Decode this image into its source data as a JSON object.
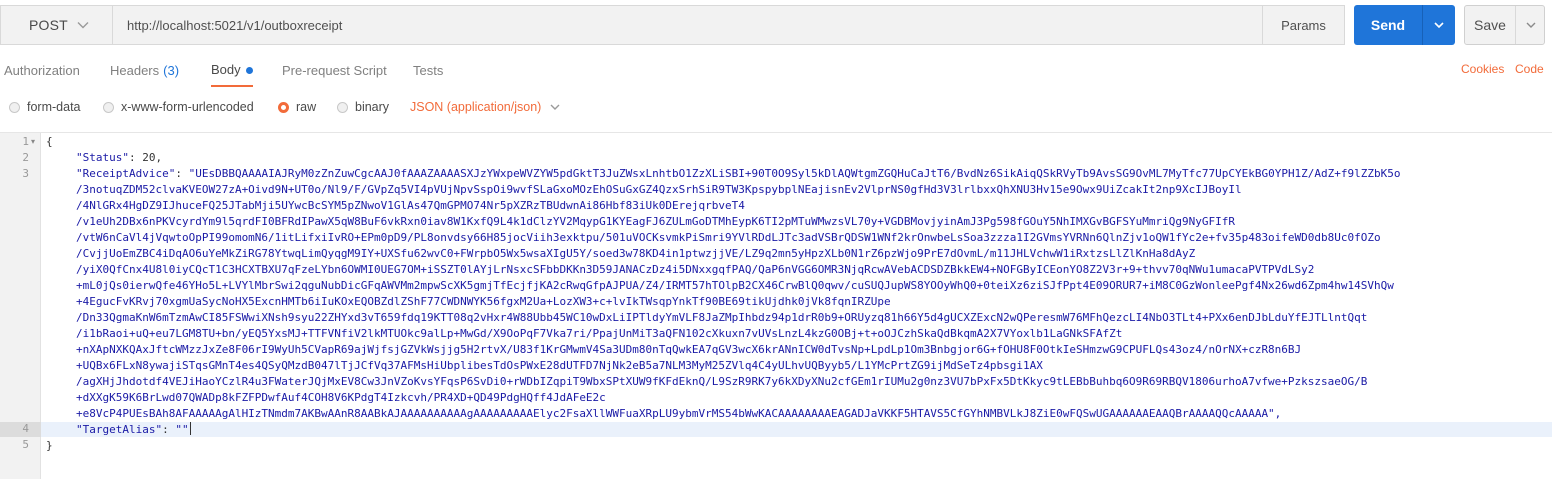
{
  "request": {
    "method": "POST",
    "url": "http://localhost:5021/v1/outboxreceipt",
    "params_label": "Params",
    "send_label": "Send",
    "save_label": "Save"
  },
  "tabs": [
    {
      "label": "Authorization"
    },
    {
      "label": "Headers",
      "count": "(3)"
    },
    {
      "label": "Body",
      "active": true
    },
    {
      "label": "Pre-request Script"
    },
    {
      "label": "Tests"
    }
  ],
  "right_links": {
    "cookies": "Cookies",
    "code": "Code"
  },
  "body_types": [
    {
      "label": "form-data",
      "selected": false
    },
    {
      "label": "x-www-form-urlencoded",
      "selected": false
    },
    {
      "label": "raw",
      "selected": true
    },
    {
      "label": "binary",
      "selected": false
    }
  ],
  "content_type": "JSON (application/json)",
  "editor": {
    "line_numbers": [
      "1",
      "2",
      "3",
      "4",
      "5"
    ],
    "open_brace": "{",
    "close_brace": "}",
    "status_key": "\"Status\"",
    "status_value": "20",
    "receipt_key": "\"ReceiptAdvice\"",
    "target_key": "\"TargetAlias\"",
    "target_value": "\"\"",
    "receipt_lines": [
      "\"UEsDBBQAAAAIAJRyM0zZnZuwCgcAAJ0fAAAZAAAASXJzYWxpeWVZYW5pdGktT3JuZWsxLnhtbO1ZzXLiSBI+90T0O9Syl5kDlAQWtgmZGQHuCaJtT6/BvdNz6SikAiqQSkRVyTb9AvsSG9OvML7MyTfc77UpCYEkBG0YPH1Z/AdZ+f9lZZbK5o",
      "/3notuqZDM52clvaKVEOW27zA+Oivd9N+UT0o/Nl9/F/GVpZq5VI4pVUjNpvSspOi9wvfSLaGxoMOzEhOSuGxGZ4QzxSrhSiR9TW3KpspybplNEajisnEv2VlprNS0gfHd3V3lrlbxxQhXNU3Hv15e9Owx9UiZcakIt2np9XcIJBoyIl",
      "/4NlGRx4HgDZ9IJhuceFQ25JTabMji5UYwcBcSYM5pZNwoV1GlAs47QmGPMO74Nr5pXZRzTBUdwnAi86Hbf83iUk0DErejqrbveT4",
      "/v1eUh2DBx6nPKVcyrdYm9l5qrdFI0BFRdIPawX5qW8BuF6vkRxn0iav8W1KxfQ9L4k1dClzYV2MqypG1KYEagFJ6ZULmGoDTMhEypK6TI2pMTuWMwzsVL70y+VGDBMovjyinAmJ3Pg598fGOuY5NhIMXGvBGFSYuMmriQg9NyGFIfR",
      "/vtW6nCaVl4jVqwtoOpPI99omomN6/1itLifxiIvRO+EPm0pD9/PL8onvdsy66H85jocViih3exktpu/501uVOCKsvmkPiSmri9YVlRDdLJTc3adVSBrQDSW1WNf2krOnwbeLsSoa3zzza1I2GVmsYVRNn6QlnZjv1oQW1fYc2e+fv35p483oifeWD0db8Uc0fOZo",
      "/CvjjUoEmZBC4iDqAO6uYeMkZiRG78YtwqLimQyqgM9IY+UXSfu62wvC0+FWrpbO5Wx5wsaXIgU5Y/soed3w78KD4in1ptwzjjVE/LZ9q2mn5yHpzXLb0N1rZ6pzWjo9PrE7dOvmL/m11JHLVchwW1iRxtzsLlZlKnHa8dAyZ",
      "/yiX0QfCnx4U8l0iyCQcT1C3HCXTBXU7qFzeLYbn6OWMI0UEG7OM+iSSZT0lAYjLrNsxcSFbbDKKn3D59JANACzDz4i5DNxxgqfPAQ/QaP6nVGG6OMR3NjqRcwAVebACDSDZBkkEW4+NOFGByICEonYO8Z2V3r+9+thvv70qNWu1umacaPVTPVdLSy2",
      "+mL0jQs0ierwQfe46YHo5L+LVYlMbrSwi2qguNubDicGFqAWVMm2mpwScXK5gmjTfEcjfjKA2cRwqGfpAJPUA/Z4/IRMT57hTOlpB2CX46CrwBlQ0qwv/cuSUQJupWS8YOOyWhQ0+0teiXz6ziSJfPpt4E09ORUR7+iM8C0GzWonleePgf4Nx26wd6Zpm4hw14SVhQw",
      "+4EgucFvKRvj70xgmUaSycNoHX5ExcnHMTb6iIuKOxEQOBZdlZShF77CWDNWYK56fgxM2Ua+LozXW3+c+lvIkTWsqpYnkTf90BE69tikUjdhk0jVk8fqnIRZUpe",
      "/Dn33QgmaKnW6mTzmAwCI85FSWwiXNsh9syu22ZHYxd3vT659fdq19KTT08q2vHxr4W88Ubb45WC10wDxLiIPTldyYmVLF8JaZMpIhbdz94p1drR0b9+ORUyzq81h66Y5d4gUCXZExcN2wQPeresmW76MFhQezcLI4NbO3TLt4+PXx6enDJbLduYfEJTLlntQqt",
      "/i1bRaoi+uQ+eu7LGM8TU+bn/yEQ5YxsMJ+TTFVNfiV2lkMTUOkc9alLp+MwGd/X9OoPqF7Vka7ri/PpajUnMiT3aQFN102cXkuxn7vUVsLnzL4kzG0OBj+t+oOJCzhSkaQdBkqmA2X7VYoxlb1LaGNkSFAfZt",
      "+nXApNXKQAxJftcWMzzJxZe8F06rI9WyUh5CVapR69ajWjfsjGZVkWsjjg5H2rtvX/U83f1KrGMwmV4Sa3UDm80nTqQwkEA7qGV3wcX6krANnICW0dTvsNp+LpdLp1Om3Bnbgjor6G+fOHU8F0OtkIeSHmzwG9CPUFLQs43oz4/nOrNX+czR8n6BJ",
      "+UQBx6FLxN8ywajiSTqsGMnT4es4QSyQMzdB047lTjJCfVq37AFMsHiUbplibesTdOsPWxE28dUTFD7NjNk2eB5a7NLM3MyM25ZVlq4C4yULhvUQByyb5/L1YMcPrtZG9ijMdSeTz4pbsgi1AX",
      "/agXHjJhdotdf4VEJiHaoYCzlR4u3FWaterJQjMxEV8Cw3JnVZoKvsYFqsP6SvDi0+rWDbIZqpiT9WbxSPtXUW9fKFdEknQ/L9SzR9RK7y6kXDyXNu2cfGEm1rIUMu2g0nz3VU7bPxFx5DtKkyc9tLEBbBuhbq6O9R69RBQV1806urhoA7vfwe+PzkszsaeOG/B",
      "+dXXgK59K6BrLwd07QWADp8kFZFPDwfAuf4COH8V6KPdgT4Izkcvh/PR4XD+QD49PdgHQff4JdAFeE2c",
      "+e8VcP4PUEsBAh8AFAAAAAgAlHIzTNmdm7AKBwAAnR8AABkAJAAAAAAAAAAgAAAAAAAAAElyc2FsaXllWWFuaXRpLU9ybmVrMS54bWwKACAAAAAAAAEAGADJaVKKF5HTAVS5CfGYhNMBVLkJ8ZiE0wFQSwUGAAAAAAEAAQBrAAAAQQcAAAAA\","
    ]
  }
}
